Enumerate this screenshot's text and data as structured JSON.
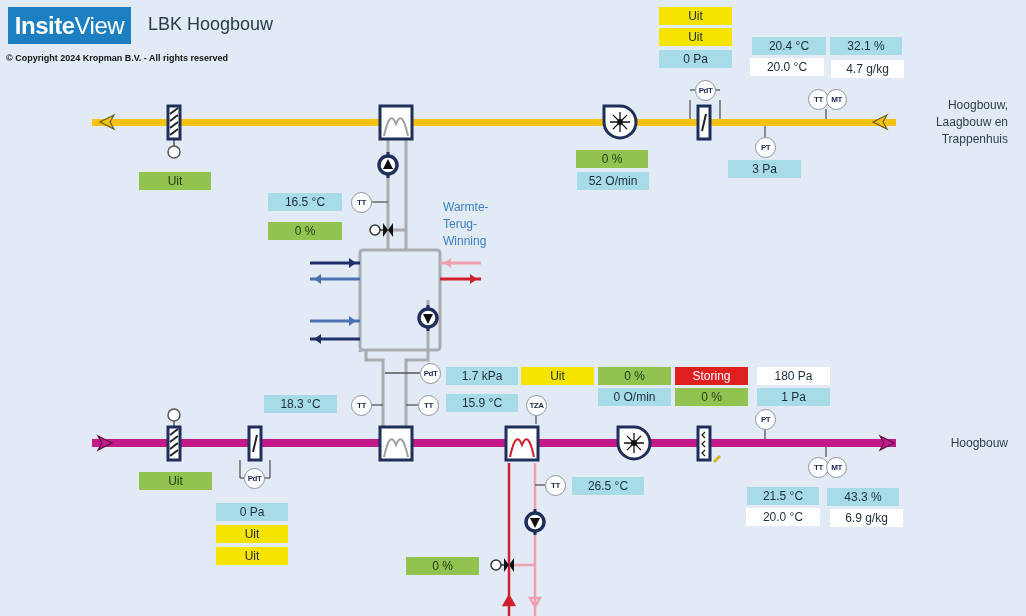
{
  "header": {
    "logo": "**Insite**View",
    "title": "LBK Hoogbouw",
    "copyright": "© Copyright 2024 Kropman B.V. - All rights reserved"
  },
  "readouts": [
    {
      "text": "Uit",
      "kind": "command"
    },
    {
      "text": "16.5 °C",
      "kind": "measured"
    },
    {
      "text": "0 %",
      "kind": "command"
    },
    {
      "text": "Uit",
      "kind": "status"
    },
    {
      "text": "Uit",
      "kind": "status"
    },
    {
      "text": "0 Pa",
      "kind": "measured"
    },
    {
      "text": "20.4 °C",
      "kind": "measured"
    },
    {
      "text": "20.0 °C",
      "kind": "setpoint"
    },
    {
      "text": "32.1 %",
      "kind": "measured"
    },
    {
      "text": "4.7 g/kg",
      "kind": "setpoint"
    },
    {
      "text": "0 %",
      "kind": "command"
    },
    {
      "text": "52 O/min",
      "kind": "measured"
    },
    {
      "text": "3 Pa",
      "kind": "measured"
    },
    {
      "text": "1.7 kPa",
      "kind": "measured"
    },
    {
      "text": "15.9 °C",
      "kind": "measured"
    },
    {
      "text": "Uit",
      "kind": "status"
    },
    {
      "text": "0 %",
      "kind": "command"
    },
    {
      "text": "0 O/min",
      "kind": "measured"
    },
    {
      "text": "Storing",
      "kind": "alarm"
    },
    {
      "text": "0 %",
      "kind": "command"
    },
    {
      "text": "180 Pa",
      "kind": "setpoint"
    },
    {
      "text": "1 Pa",
      "kind": "measured"
    },
    {
      "text": "18.3 °C",
      "kind": "measured"
    },
    {
      "text": "Uit",
      "kind": "command"
    },
    {
      "text": "0 Pa",
      "kind": "measured"
    },
    {
      "text": "Uit",
      "kind": "status"
    },
    {
      "text": "Uit",
      "kind": "status"
    },
    {
      "text": "26.5 °C",
      "kind": "measured"
    },
    {
      "text": "21.5 °C",
      "kind": "measured"
    },
    {
      "text": "20.0 °C",
      "kind": "setpoint"
    },
    {
      "text": "43.3 %",
      "kind": "measured"
    },
    {
      "text": "6.9 g/kg",
      "kind": "setpoint"
    },
    {
      "text": "0 %",
      "kind": "command"
    }
  ],
  "sensors": [
    {
      "tag": "TT"
    },
    {
      "tag": "PdT"
    },
    {
      "tag": "TT"
    },
    {
      "tag": "MT"
    },
    {
      "tag": "PT"
    },
    {
      "tag": "PdT"
    },
    {
      "tag": "TT"
    },
    {
      "tag": "TT"
    },
    {
      "tag": "TZA"
    },
    {
      "tag": "PT"
    },
    {
      "tag": "TT"
    },
    {
      "tag": "TT"
    },
    {
      "tag": "MT"
    },
    {
      "tag": "PdT"
    }
  ],
  "labels": [
    {
      "text": "Warmte-\nTerug-\nWinning",
      "kind": "unit"
    },
    {
      "text": "Hoogbouw,\nLaagbouw en\nTrappenhuis",
      "kind": "destination"
    },
    {
      "text": "Hoogbouw",
      "kind": "destination"
    }
  ]
}
